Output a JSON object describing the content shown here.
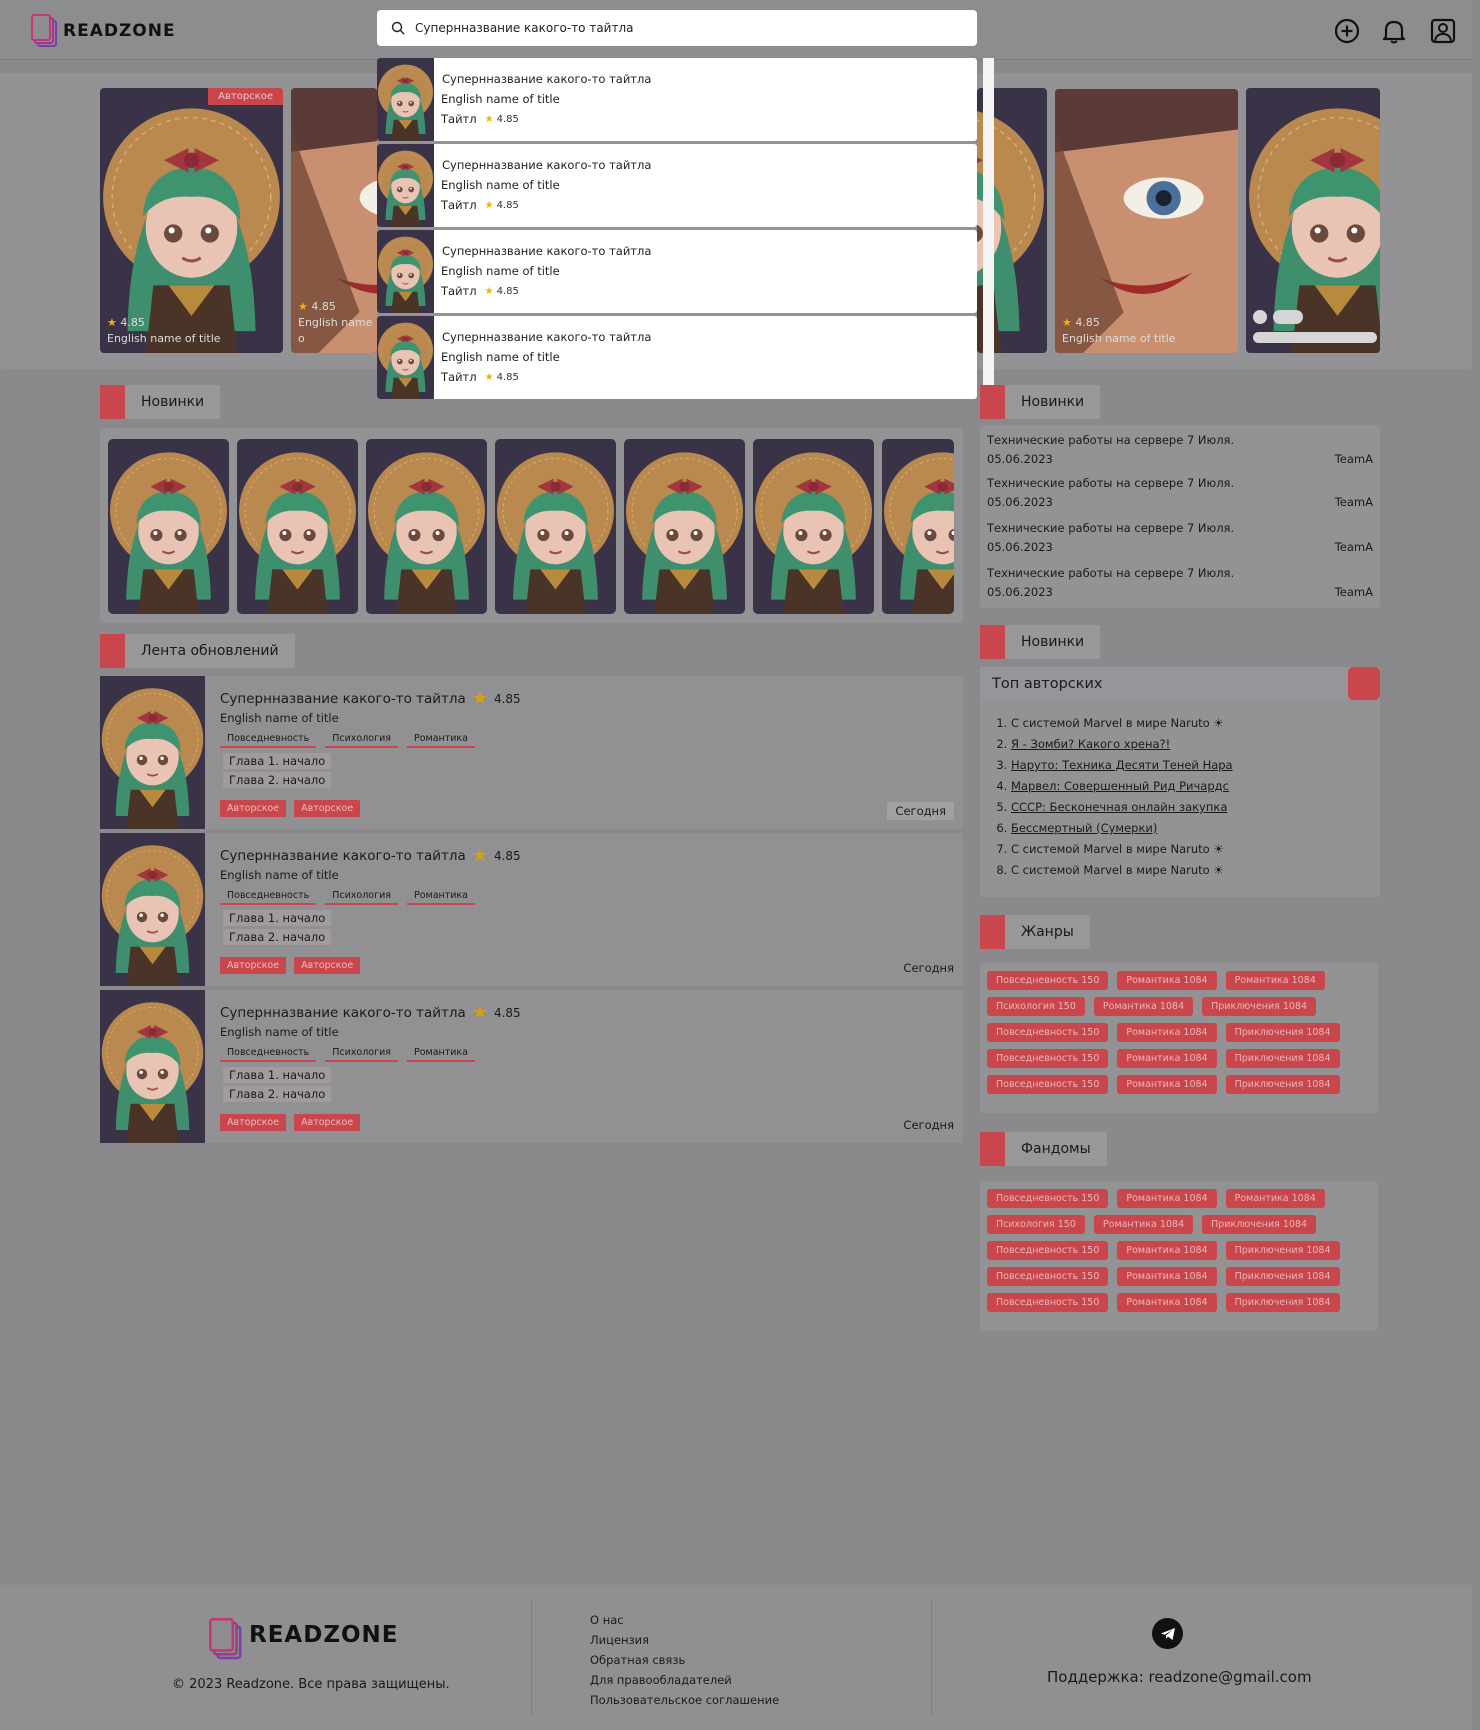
{
  "header": {
    "logo_text": "READZONE",
    "search_value": "Супернназвание какого-то тайтла",
    "icons": [
      "plus-circle-icon",
      "bell-icon",
      "profile-icon"
    ]
  },
  "hero": {
    "first_badge": "Авторское",
    "posters": [
      {
        "rating": "4.85",
        "name": "English name of title"
      },
      {
        "rating": "4.85",
        "name": "English name o"
      },
      {
        "rating": "4.85",
        "name": "English name of title"
      }
    ]
  },
  "dropdown": {
    "items": [
      {
        "title": "Супернназвание какого-то тайтла",
        "en": "English name of title",
        "type": "Тайтл",
        "rating": "4.85"
      },
      {
        "title": "Супернназвание какого-то тайтла",
        "en": "English name of title",
        "type": "Тайтл",
        "rating": "4.85"
      },
      {
        "title": "Супернназвание какого-то тайтла",
        "en": "English name of title",
        "type": "Тайтл",
        "rating": "4.85"
      },
      {
        "title": "Супернназвание какого-то тайтла",
        "en": "English name of title",
        "type": "Тайтл",
        "rating": "4.85"
      }
    ]
  },
  "sections": {
    "novinki": "Новинки",
    "feed": "Лента обновлений",
    "news": "Новинки",
    "novinki2": "Новинки",
    "genres": "Жанры",
    "fandoms": "Фандомы"
  },
  "feed": {
    "items": [
      {
        "title": "Супернназвание какого-то тайтла",
        "rating": "4.85",
        "en": "English name of title",
        "tags": [
          "Повседневность",
          "Психология",
          "Романтика"
        ],
        "chapters": [
          "Глава 1. начало",
          "Глава 2. начало"
        ],
        "badges": [
          "Авторское",
          "Авторское"
        ],
        "when": "Сегодня"
      },
      {
        "title": "Супернназвание какого-то тайтла",
        "rating": "4.85",
        "en": "English name of title",
        "tags": [
          "Повседневность",
          "Психология",
          "Романтика"
        ],
        "chapters": [
          "Глава 1. начало",
          "Глава 2. начало"
        ],
        "badges": [
          "Авторское",
          "Авторское"
        ],
        "when": "Сегодня"
      },
      {
        "title": "Супернназвание какого-то тайтла",
        "rating": "4.85",
        "en": "English name of title",
        "tags": [
          "Повседневность",
          "Психология",
          "Романтика"
        ],
        "chapters": [
          "Глава 1. начало",
          "Глава 2. начало"
        ],
        "badges": [
          "Авторское",
          "Авторское"
        ],
        "when": "Сегодня"
      }
    ]
  },
  "news": {
    "items": [
      {
        "text": "Технические работы на сервере 7 Июля.",
        "date": "05.06.2023",
        "author": "TeamA"
      },
      {
        "text": "Технические работы на сервере 7 Июля.",
        "date": "05.06.2023",
        "author": "TeamA"
      },
      {
        "text": "Технические работы на сервере 7 Июля.",
        "date": "05.06.2023",
        "author": "TeamA"
      },
      {
        "text": "Технические работы на сервере 7 Июля.",
        "date": "05.06.2023",
        "author": "TeamA"
      }
    ]
  },
  "top": {
    "title": "Топ авторских",
    "items": [
      "С системой Marvel в мире Naruto ☀",
      "Я - Зомби? Какого хрена?!",
      "Наруто: Техника Десяти Теней Нара",
      "Марвел: Совершенный Рид Ричардс",
      "СССР: Бесконечная онлайн закупка",
      "Бессмертный (Сумерки)",
      "С системой Marvel в мире Naruto ☀",
      "С системой Marvel в мире Naruto ☀"
    ]
  },
  "genres": {
    "rows": [
      [
        "Повседневность  150",
        "Романтика  1084",
        "Романтика  1084"
      ],
      [
        "Психология  150",
        "Романтика  1084",
        "Приключения  1084"
      ],
      [
        "Повседневность  150",
        "Романтика  1084",
        "Приключения  1084"
      ],
      [
        "Повседневность  150",
        "Романтика  1084",
        "Приключения  1084"
      ],
      [
        "Повседневность  150",
        "Романтика  1084",
        "Приключения  1084"
      ]
    ]
  },
  "fandoms": {
    "rows": [
      [
        "Повседневность  150",
        "Романтика  1084",
        "Романтика  1084"
      ],
      [
        "Психология  150",
        "Романтика  1084",
        "Приключения  1084"
      ],
      [
        "Повседневность  150",
        "Романтика  1084",
        "Приключения  1084"
      ],
      [
        "Повседневность  150",
        "Романтика  1084",
        "Приключения  1084"
      ],
      [
        "Повседневность  150",
        "Романтика  1084",
        "Приключения  1084"
      ]
    ]
  },
  "footer": {
    "logo_text": "READZONE",
    "copyright": "© 2023 Readzone. Все права защищены.",
    "links": [
      "О нас",
      "Лицензия",
      "Обратная связь",
      "Для правообладателей",
      "Пользовательское соглашение"
    ],
    "support": "Поддержка: readzone@gmail.com",
    "telegram_icon": "telegram-icon"
  },
  "colors": {
    "accent": "#c9474c",
    "overlay": "#8a8a8d",
    "star": "#f0b400"
  }
}
